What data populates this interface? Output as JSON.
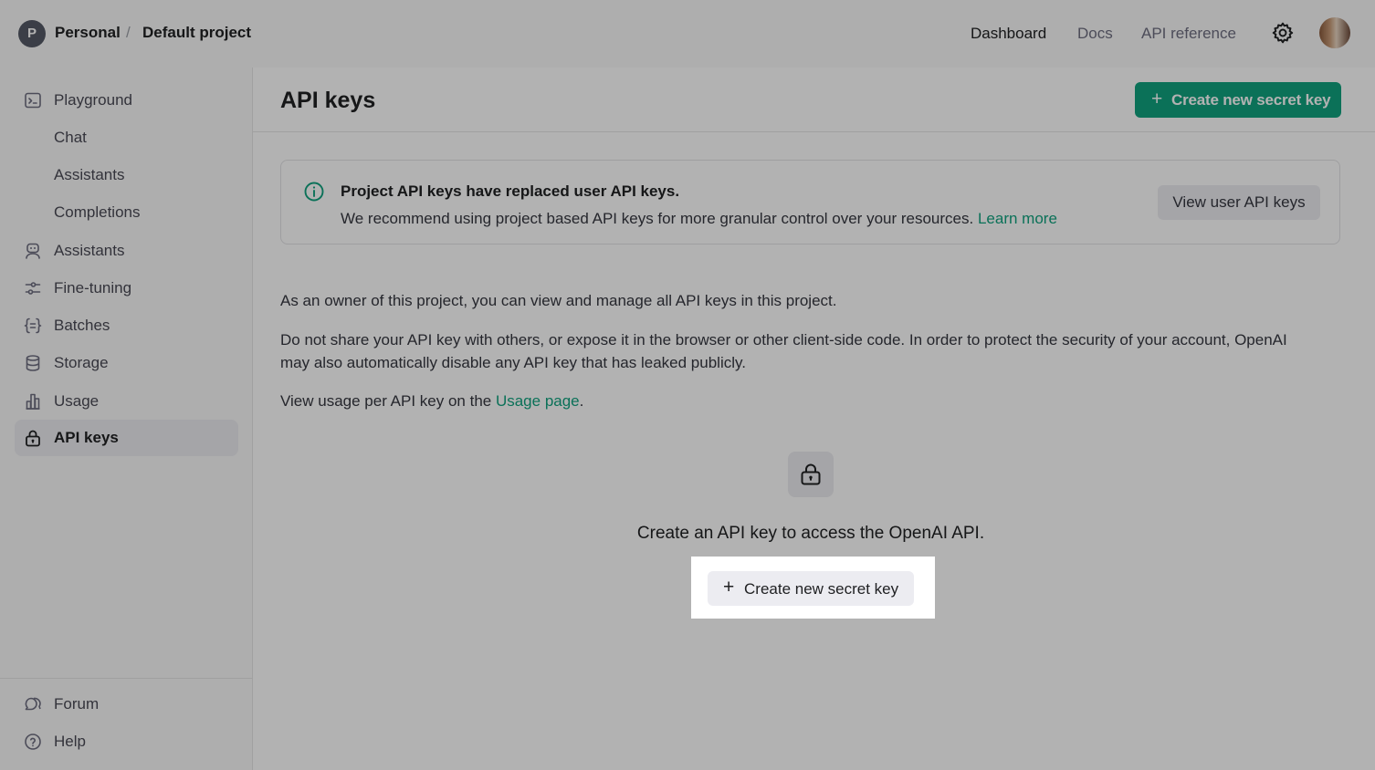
{
  "header": {
    "org_initial": "P",
    "org_name": "Personal",
    "separator": "/",
    "project_name": "Default project",
    "nav": [
      "Dashboard",
      "Docs",
      "API reference"
    ],
    "settings_icon": "gear-icon",
    "avatar_icon": "user-avatar"
  },
  "sidebar": {
    "items": [
      {
        "label": "Playground",
        "icon": "terminal-icon"
      },
      {
        "label": "Chat",
        "icon": ""
      },
      {
        "label": "Assistants",
        "icon": ""
      },
      {
        "label": "Completions",
        "icon": ""
      },
      {
        "label": "Assistants",
        "icon": "robot-icon"
      },
      {
        "label": "Fine-tuning",
        "icon": "sliders-icon"
      },
      {
        "label": "Batches",
        "icon": "braces-icon"
      },
      {
        "label": "Storage",
        "icon": "database-icon"
      },
      {
        "label": "Usage",
        "icon": "bar-chart-icon"
      },
      {
        "label": "API keys",
        "icon": "lock-icon",
        "active": true
      }
    ],
    "footer": [
      {
        "label": "Forum",
        "icon": "chat-bubbles-icon"
      },
      {
        "label": "Help",
        "icon": "help-circle-icon"
      }
    ]
  },
  "main": {
    "title": "API keys",
    "create_button": "Create new secret key",
    "notice": {
      "title": "Project API keys have replaced user API keys.",
      "body": "We recommend using project based API keys for more granular control over your resources.",
      "link": "Learn more",
      "button": "View user API keys"
    },
    "para1": "As an owner of this project, you can view and manage all API keys in this project.",
    "para2_line1": "Do not share your API key with others, or expose it in the browser or other client-side code. In order to protect the security of your account, OpenAI",
    "para2_line2": "may also automatically disable any API key that has leaked publicly.",
    "para3_prefix": "View usage per API key on the ",
    "para3_link": "Usage page",
    "para3_suffix": ".",
    "empty_state": {
      "title": "Create an API key to access the OpenAI API.",
      "button": "Create new secret key"
    }
  },
  "colors": {
    "accent": "#10a37f",
    "sidebar_bg": "#f9f9f9",
    "active_bg": "#ececf1"
  }
}
